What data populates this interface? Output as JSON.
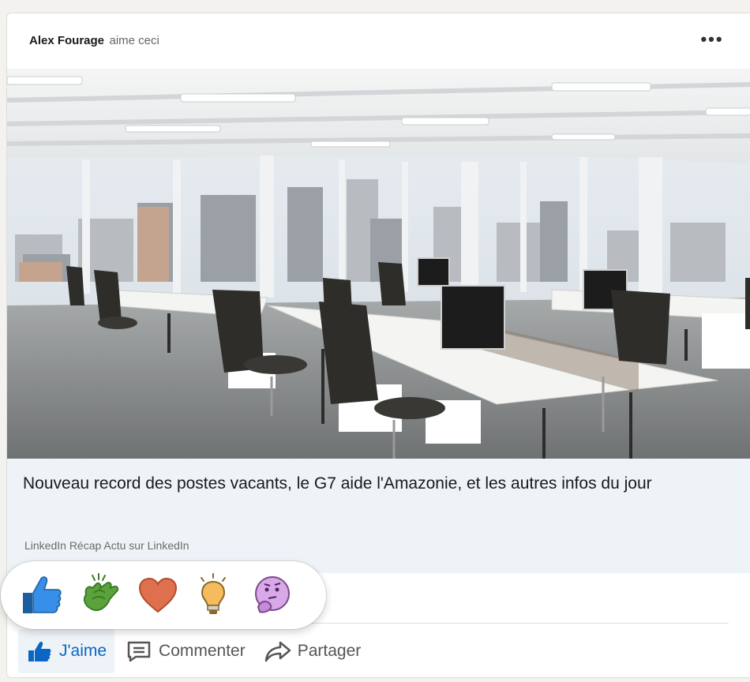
{
  "post": {
    "actor_name": "Alex Fourage",
    "actor_verb": "aime ceci",
    "more_label": "•••"
  },
  "article": {
    "title": "Nouveau record des postes vacants, le G7 aide l'Amazonie, et les autres infos du jour",
    "subtitle": "LinkedIn Récap Actu sur LinkedIn"
  },
  "reactions": [
    {
      "name": "like",
      "icon": "thumbs-up-icon",
      "color": "#378fe9"
    },
    {
      "name": "celebrate",
      "icon": "clapping-hands-icon",
      "color": "#5aa33b"
    },
    {
      "name": "love",
      "icon": "heart-icon",
      "color": "#df704d"
    },
    {
      "name": "insightful",
      "icon": "light-bulb-icon",
      "color": "#f5bb5c"
    },
    {
      "name": "curious",
      "icon": "thinking-face-icon",
      "color": "#d9a8e8"
    }
  ],
  "actions": {
    "like_label": "J'aime",
    "comment_label": "Commenter",
    "share_label": "Partager"
  },
  "colors": {
    "accent": "#0a66c2",
    "article_bg": "#eef3f8"
  }
}
